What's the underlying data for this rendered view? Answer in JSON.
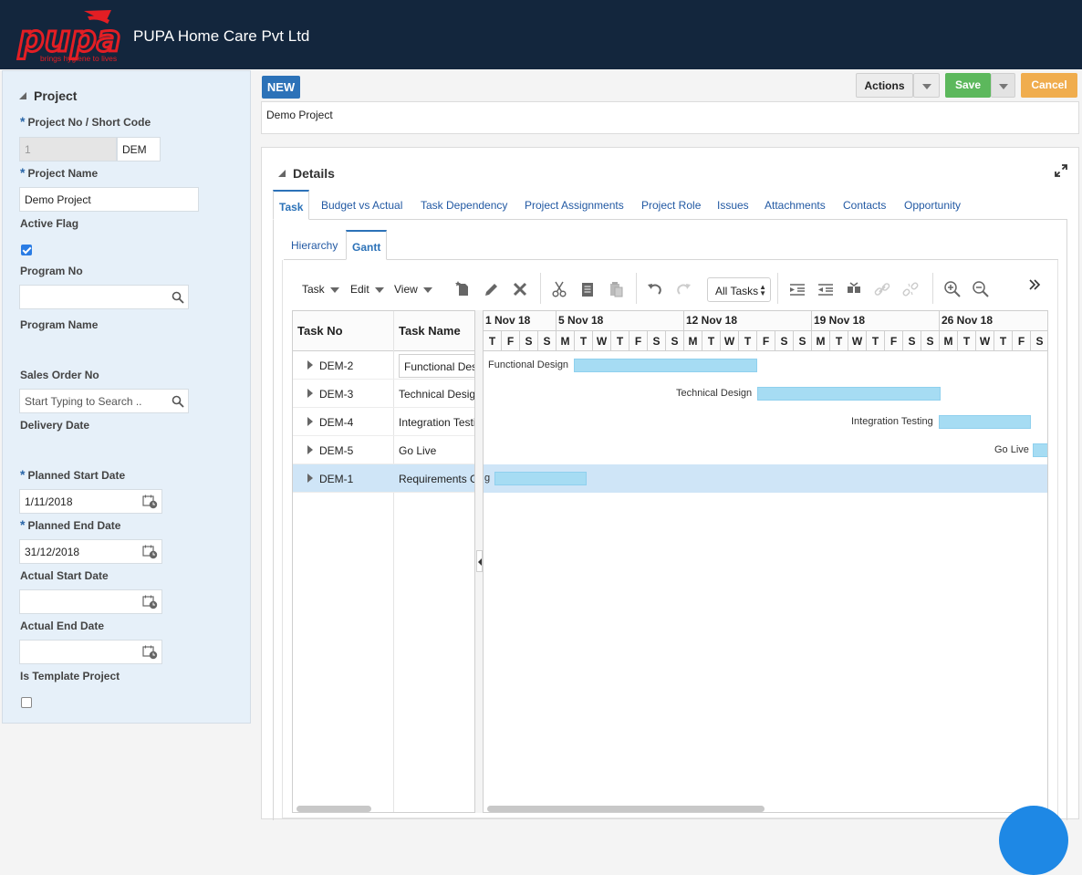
{
  "header": {
    "logo_text": "pupa",
    "logo_tagline": "brings hygiene to lives",
    "company": "PUPA Home Care Pvt Ltd"
  },
  "left_panel": {
    "section_title": "Project",
    "project_no_label": "Project No / Short Code",
    "project_no_value": "1",
    "short_code_value": "DEM",
    "project_name_label": "Project Name",
    "project_name_value": "Demo Project",
    "active_flag_label": "Active Flag",
    "active_flag_checked": true,
    "program_no_label": "Program No",
    "program_no_value": "",
    "program_name_label": "Program Name",
    "sales_order_label": "Sales Order No",
    "sales_order_placeholder": "Start Typing to Search ..",
    "delivery_date_label": "Delivery Date",
    "planned_start_label": "Planned Start Date",
    "planned_start_value": "1/11/2018",
    "planned_end_label": "Planned End Date",
    "planned_end_value": "31/12/2018",
    "actual_start_label": "Actual Start Date",
    "actual_start_value": "",
    "actual_end_label": "Actual End Date",
    "actual_end_value": "",
    "template_label": "Is Template Project",
    "template_checked": false
  },
  "record": {
    "badge": "NEW",
    "title": "Demo Project"
  },
  "actions": {
    "actions_label": "Actions",
    "save_label": "Save",
    "cancel_label": "Cancel"
  },
  "details": {
    "title": "Details",
    "tabs": [
      "Task",
      "Budget vs Actual",
      "Task Dependency",
      "Project Assignments",
      "Project Role",
      "Issues",
      "Attachments",
      "Contacts",
      "Opportunity"
    ],
    "active_tab": "Task",
    "subtabs": [
      "Hierarchy",
      "Gantt"
    ],
    "active_subtab": "Gantt"
  },
  "gantt": {
    "menus": [
      "Task",
      "Edit",
      "View"
    ],
    "filter_value": "All Tasks",
    "columns": [
      "Task No",
      "Task Name"
    ],
    "weeks": [
      "1 Nov 18",
      "5 Nov 18",
      "12 Nov 18",
      "19 Nov 18",
      "26 Nov 18"
    ],
    "day_letters": [
      "T",
      "F",
      "S",
      "S",
      "M",
      "T",
      "W",
      "T",
      "F",
      "S",
      "S",
      "M",
      "T",
      "W",
      "T",
      "F",
      "S",
      "S",
      "M",
      "T",
      "W",
      "T",
      "F",
      "S",
      "S",
      "M",
      "T",
      "W",
      "T",
      "F",
      "S"
    ],
    "tasks": [
      {
        "no": "DEM-2",
        "name": "Functional Design",
        "bar_label": "Functional Design"
      },
      {
        "no": "DEM-3",
        "name": "Technical Design",
        "bar_label": "Technical Design"
      },
      {
        "no": "DEM-4",
        "name": "Integration Testing",
        "bar_label": "Integration Testing"
      },
      {
        "no": "DEM-5",
        "name": "Go Live",
        "bar_label": "Go Live"
      },
      {
        "no": "DEM-1",
        "name": "Requirements Gathering",
        "bar_label": "g"
      }
    ],
    "selected_task": "DEM-1"
  },
  "colors": {
    "header_bg": "#13263d",
    "logo_red": "#e31e24",
    "accent_blue": "#2c72b8",
    "save_green": "#5cb85c",
    "cancel_orange": "#f0ad4e",
    "bar_fill": "#a6dcf3",
    "selected_row": "#cfe5f7"
  }
}
